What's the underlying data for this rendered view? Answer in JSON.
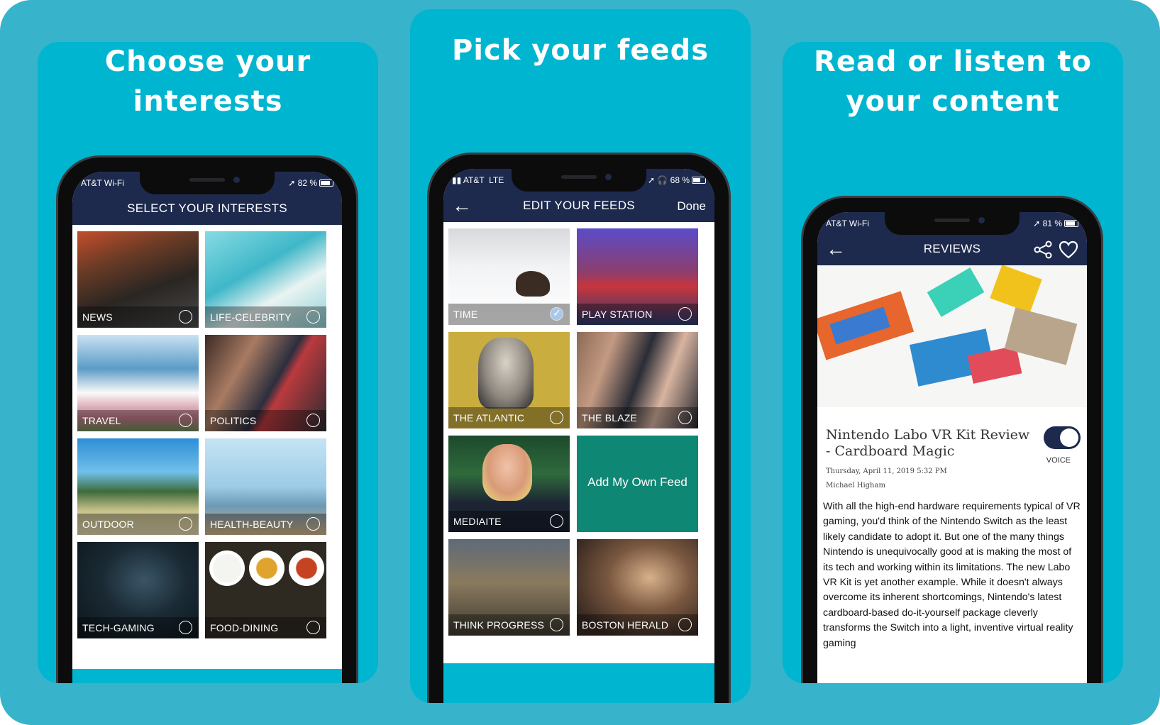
{
  "panels": [
    {
      "title_line1": "Choose your",
      "title_line2": "interests",
      "status": {
        "carrier": "AT&T Wi-Fi",
        "battery": "82 %"
      },
      "nav_title": "SELECT YOUR INTERESTS",
      "tiles": [
        {
          "label": "NEWS",
          "selected": false
        },
        {
          "label": "LIFE-CELEBRITY",
          "selected": false
        },
        {
          "label": "TRAVEL",
          "selected": false
        },
        {
          "label": "POLITICS",
          "selected": false
        },
        {
          "label": "OUTDOOR",
          "selected": false
        },
        {
          "label": "HEALTH-BEAUTY",
          "selected": false
        },
        {
          "label": "TECH-GAMING",
          "selected": false
        },
        {
          "label": "FOOD-DINING",
          "selected": false
        }
      ]
    },
    {
      "title_line1": "Pick your feeds",
      "status": {
        "carrier": "AT&T",
        "network": "LTE",
        "battery": "68 %"
      },
      "nav_title": "EDIT YOUR FEEDS",
      "done_label": "Done",
      "tiles": [
        {
          "label": "TIME",
          "selected": true
        },
        {
          "label": "PLAY STATION",
          "selected": false
        },
        {
          "label": "THE ATLANTIC",
          "selected": false
        },
        {
          "label": "THE BLAZE",
          "selected": false
        },
        {
          "label": "MEDIAITE",
          "selected": false
        },
        {
          "label": "Add My Own Feed",
          "selected": false
        },
        {
          "label": "THINK PROGRESS",
          "selected": false
        },
        {
          "label": "BOSTON HERALD",
          "selected": false
        }
      ]
    },
    {
      "title_line1": "Read or listen to",
      "title_line2": "your content",
      "status": {
        "carrier": "AT&T Wi-Fi",
        "battery": "81 %"
      },
      "nav_title": "REVIEWS",
      "article": {
        "title": "Nintendo Labo VR Kit Review - Cardboard Magic",
        "date": "Thursday, April 11, 2019 5:32 PM",
        "author": "Michael Higham",
        "voice_label": "VOICE",
        "voice_on": true,
        "body": "With all the high-end hardware requirements typical of VR gaming, you'd think of the Nintendo Switch as the least likely candidate to adopt it. But one of the many things Nintendo is unequivocally good at is making the most of its tech and working within its limitations. The new Labo VR Kit is yet another example. While it doesn't always overcome its inherent shortcomings, Nintendo's latest cardboard-based do-it-yourself package cleverly transforms the Switch into a light, inventive virtual reality gaming"
      }
    }
  ],
  "colors": {
    "background": "#37b3cb",
    "panel": "#00b5cf",
    "navbar": "#1d2a4d",
    "add_feed_tile": "#0e8774"
  }
}
